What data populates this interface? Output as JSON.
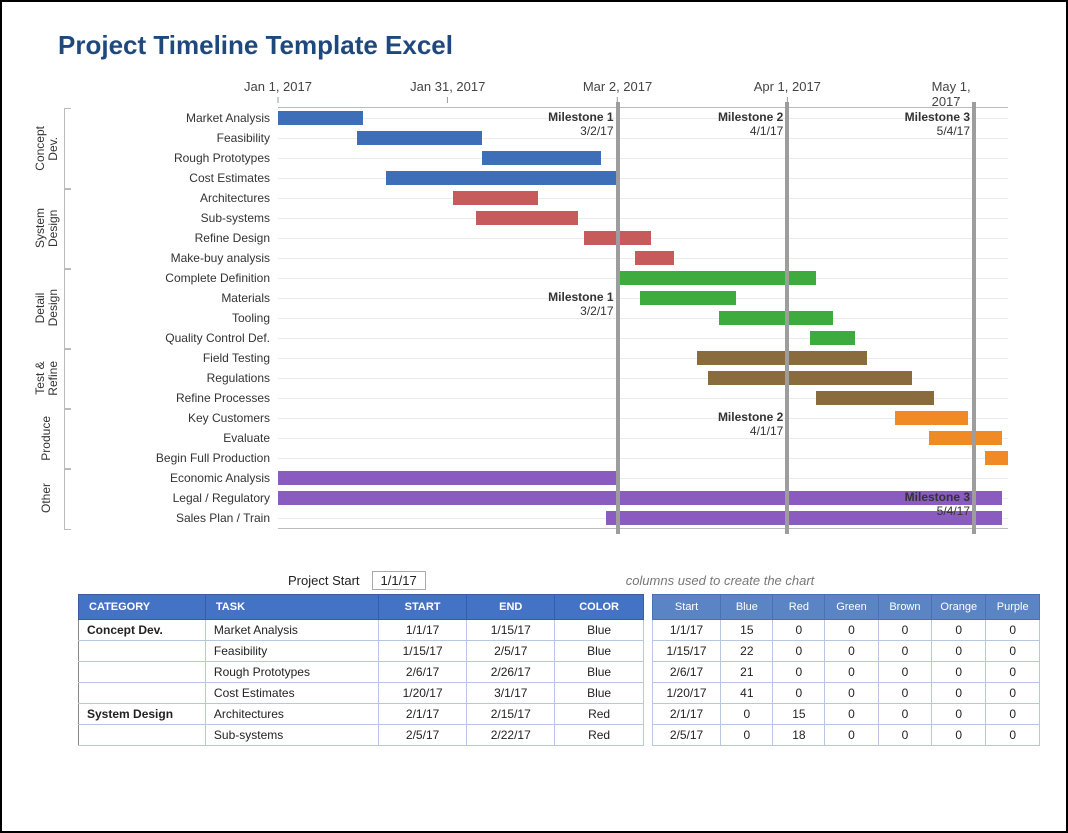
{
  "title": "Project Timeline Template Excel",
  "colors": {
    "Blue": "#3d6eb7",
    "Red": "#c75a5a",
    "Green": "#3eab3e",
    "Brown": "#8a6b3e",
    "Orange": "#f08a24",
    "Purple": "#8a5cc0"
  },
  "chart_data": {
    "type": "gantt",
    "timeline": {
      "startDate": "2017-01-01",
      "endDate": "2017-05-10",
      "totalDays": 129,
      "ticks": [
        {
          "label": "Jan 1, 2017",
          "offsetDays": 0
        },
        {
          "label": "Jan 31, 2017",
          "offsetDays": 30
        },
        {
          "label": "Mar 2, 2017",
          "offsetDays": 60
        },
        {
          "label": "Apr 1, 2017",
          "offsetDays": 90
        },
        {
          "label": "May 1, 2017",
          "offsetDays": 120
        }
      ]
    },
    "milestones": [
      {
        "name": "Milestone 1",
        "date": "3/2/17",
        "offsetDays": 60,
        "topLabelRow": 0,
        "midLabelRow": 9
      },
      {
        "name": "Milestone 2",
        "date": "4/1/17",
        "offsetDays": 90,
        "topLabelRow": 0,
        "midLabelRow": 15
      },
      {
        "name": "Milestone 3",
        "date": "5/4/17",
        "offsetDays": 123,
        "topLabelRow": 0,
        "midLabelRow": 19
      }
    ],
    "categories": [
      {
        "name": "Concept Dev.",
        "short": "Concept\nDev.",
        "rows": [
          0,
          1,
          2,
          3
        ]
      },
      {
        "name": "System Design",
        "short": "System\nDesign",
        "rows": [
          4,
          5,
          6,
          7
        ]
      },
      {
        "name": "Detail Design",
        "short": "Detail\nDesign",
        "rows": [
          8,
          9,
          10,
          11
        ]
      },
      {
        "name": "Test & Refine",
        "short": "Test &\nRefine",
        "rows": [
          12,
          13,
          14
        ]
      },
      {
        "name": "Produce",
        "short": "Produce",
        "rows": [
          15,
          16,
          17
        ]
      },
      {
        "name": "Other",
        "short": "Other",
        "rows": [
          18,
          19,
          20
        ]
      }
    ],
    "tasks": [
      {
        "row": 0,
        "label": "Market Analysis",
        "start": "1/1/17",
        "end": "1/15/17",
        "offsetDays": 0,
        "durationDays": 15,
        "color": "Blue"
      },
      {
        "row": 1,
        "label": "Feasibility",
        "start": "1/15/17",
        "end": "2/5/17",
        "offsetDays": 14,
        "durationDays": 22,
        "color": "Blue"
      },
      {
        "row": 2,
        "label": "Rough Prototypes",
        "start": "2/6/17",
        "end": "2/26/17",
        "offsetDays": 36,
        "durationDays": 21,
        "color": "Blue"
      },
      {
        "row": 3,
        "label": "Cost Estimates",
        "start": "1/20/17",
        "end": "3/1/17",
        "offsetDays": 19,
        "durationDays": 41,
        "color": "Blue"
      },
      {
        "row": 4,
        "label": "Architectures",
        "start": "2/1/17",
        "end": "2/15/17",
        "offsetDays": 31,
        "durationDays": 15,
        "color": "Red"
      },
      {
        "row": 5,
        "label": "Sub-systems",
        "start": "2/5/17",
        "end": "2/22/17",
        "offsetDays": 35,
        "durationDays": 18,
        "color": "Red"
      },
      {
        "row": 6,
        "label": "Refine Design",
        "start": "2/24/17",
        "end": "3/7/17",
        "offsetDays": 54,
        "durationDays": 12,
        "color": "Red"
      },
      {
        "row": 7,
        "label": "Make-buy analysis",
        "start": "3/5/17",
        "end": "3/11/17",
        "offsetDays": 63,
        "durationDays": 7,
        "color": "Red"
      },
      {
        "row": 8,
        "label": "Complete Definition",
        "start": "3/2/17",
        "end": "4/5/17",
        "offsetDays": 60,
        "durationDays": 35,
        "color": "Green"
      },
      {
        "row": 9,
        "label": "Materials",
        "start": "3/6/17",
        "end": "3/22/17",
        "offsetDays": 64,
        "durationDays": 17,
        "color": "Green"
      },
      {
        "row": 10,
        "label": "Tooling",
        "start": "3/20/17",
        "end": "4/8/17",
        "offsetDays": 78,
        "durationDays": 20,
        "color": "Green"
      },
      {
        "row": 11,
        "label": "Quality Control Def.",
        "start": "4/5/17",
        "end": "4/12/17",
        "offsetDays": 94,
        "durationDays": 8,
        "color": "Green"
      },
      {
        "row": 12,
        "label": "Field Testing",
        "start": "3/16/17",
        "end": "4/14/17",
        "offsetDays": 74,
        "durationDays": 30,
        "color": "Brown"
      },
      {
        "row": 13,
        "label": "Regulations",
        "start": "3/18/17",
        "end": "4/22/17",
        "offsetDays": 76,
        "durationDays": 36,
        "color": "Brown"
      },
      {
        "row": 14,
        "label": "Refine Processes",
        "start": "4/6/17",
        "end": "4/26/17",
        "offsetDays": 95,
        "durationDays": 21,
        "color": "Brown"
      },
      {
        "row": 15,
        "label": "Key Customers",
        "start": "4/20/17",
        "end": "5/2/17",
        "offsetDays": 109,
        "durationDays": 13,
        "color": "Orange"
      },
      {
        "row": 16,
        "label": "Evaluate",
        "start": "4/26/17",
        "end": "5/8/17",
        "offsetDays": 115,
        "durationDays": 13,
        "color": "Orange"
      },
      {
        "row": 17,
        "label": "Begin Full Production",
        "start": "5/6/17",
        "end": "5/9/17",
        "offsetDays": 125,
        "durationDays": 4,
        "color": "Orange"
      },
      {
        "row": 18,
        "label": "Economic Analysis",
        "start": "1/1/17",
        "end": "3/2/17",
        "offsetDays": 0,
        "durationDays": 60,
        "color": "Purple"
      },
      {
        "row": 19,
        "label": "Legal / Regulatory",
        "start": "1/1/17",
        "end": "5/9/17",
        "offsetDays": 0,
        "durationDays": 128,
        "color": "Purple"
      },
      {
        "row": 20,
        "label": "Sales Plan / Train",
        "start": "2/28/17",
        "end": "5/9/17",
        "offsetDays": 58,
        "durationDays": 70,
        "color": "Purple"
      }
    ]
  },
  "config": {
    "projectStartLabel": "Project Start",
    "projectStartValue": "1/1/17",
    "auxNote": "columns used to create the chart"
  },
  "mainTable": {
    "headers": [
      "CATEGORY",
      "TASK",
      "START",
      "END",
      "COLOR"
    ],
    "rows": [
      {
        "category": "Concept Dev.",
        "task": "Market Analysis",
        "start": "1/1/17",
        "end": "1/15/17",
        "color": "Blue"
      },
      {
        "category": "",
        "task": "Feasibility",
        "start": "1/15/17",
        "end": "2/5/17",
        "color": "Blue"
      },
      {
        "category": "",
        "task": "Rough Prototypes",
        "start": "2/6/17",
        "end": "2/26/17",
        "color": "Blue"
      },
      {
        "category": "",
        "task": "Cost Estimates",
        "start": "1/20/17",
        "end": "3/1/17",
        "color": "Blue"
      },
      {
        "category": "System Design",
        "task": "Architectures",
        "start": "2/1/17",
        "end": "2/15/17",
        "color": "Red"
      },
      {
        "category": "",
        "task": "Sub-systems",
        "start": "2/5/17",
        "end": "2/22/17",
        "color": "Red"
      }
    ]
  },
  "auxTable": {
    "headers": [
      "Start",
      "Blue",
      "Red",
      "Green",
      "Brown",
      "Orange",
      "Purple"
    ],
    "rows": [
      {
        "start": "1/1/17",
        "vals": [
          15,
          0,
          0,
          0,
          0,
          0
        ]
      },
      {
        "start": "1/15/17",
        "vals": [
          22,
          0,
          0,
          0,
          0,
          0
        ]
      },
      {
        "start": "2/6/17",
        "vals": [
          21,
          0,
          0,
          0,
          0,
          0
        ]
      },
      {
        "start": "1/20/17",
        "vals": [
          41,
          0,
          0,
          0,
          0,
          0
        ]
      },
      {
        "start": "2/1/17",
        "vals": [
          0,
          15,
          0,
          0,
          0,
          0
        ]
      },
      {
        "start": "2/5/17",
        "vals": [
          0,
          18,
          0,
          0,
          0,
          0
        ]
      }
    ]
  }
}
